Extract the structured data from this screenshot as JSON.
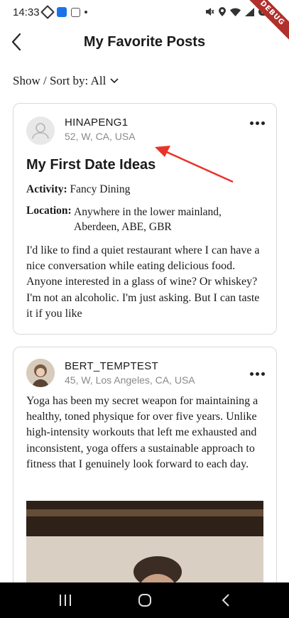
{
  "status_bar": {
    "time": "14:33",
    "badge": "DEBUG",
    "battery": "80"
  },
  "header": {
    "title": "My Favorite Posts",
    "back_icon": "chevron-left-icon"
  },
  "filter": {
    "label": "Show / Sort by: All",
    "icon": "chevron-down-icon"
  },
  "posts": [
    {
      "username": "HINAPENG1",
      "user_info": "52, W, CA, USA",
      "title": "My First Date Ideas",
      "activity_label": "Activity:",
      "activity_value": "Fancy Dining",
      "location_label": "Location:",
      "location_value": "Anywhere in the lower mainland, Aberdeen, ABE, GBR",
      "body": "I'd like to find a quiet restaurant where I can have a nice conversation while eating delicious food. Anyone interested in a glass of wine? Or whiskey? I'm not an alcoholic. I'm just asking. But I can taste it if you like"
    },
    {
      "username": "BERT_TEMPTEST",
      "user_info": "45, W, Los Angeles, CA, USA",
      "body": "Yoga has been my secret weapon for maintaining a healthy, toned physique for over five years. Unlike high-intensity workouts that left me exhausted and inconsistent, yoga offers a sustainable approach to fitness that I genuinely look forward to each day."
    }
  ],
  "colors": {
    "annotation_arrow": "#e8332a",
    "card_border": "#d9d9d9",
    "muted_text": "#8a8a8a",
    "debug_ribbon": "#b0302b"
  }
}
